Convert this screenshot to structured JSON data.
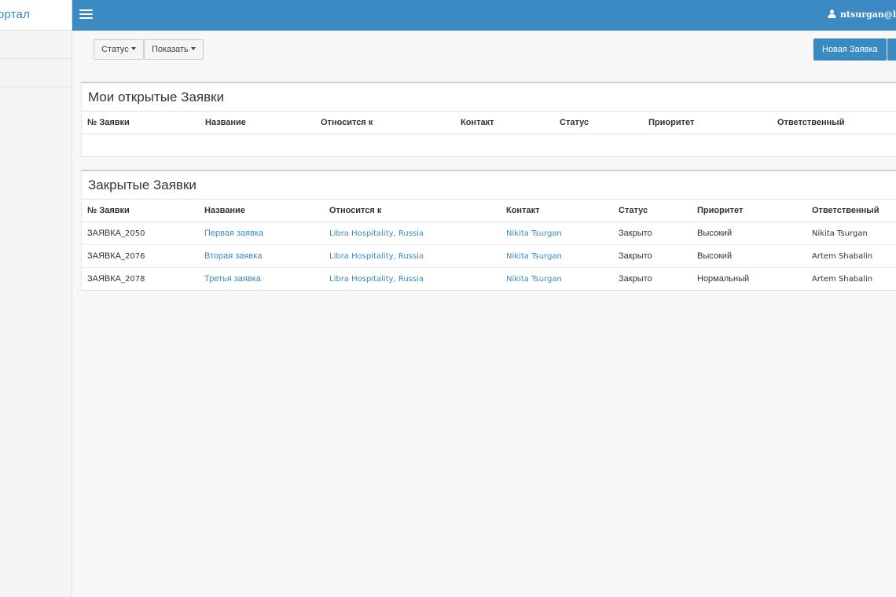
{
  "brand": {
    "title": "ортал"
  },
  "topbar": {
    "user": "ntsurgan@l"
  },
  "toolbar": {
    "status_label": "Статус",
    "show_label": "Показать",
    "new_ticket_label": "Новая Заявка"
  },
  "open_panel": {
    "title": "Мои открытые Заявки",
    "headers": [
      "№ Заявки",
      "Название",
      "Относится к",
      "Контакт",
      "Статус",
      "Приоритет",
      "Ответственный"
    ]
  },
  "closed_panel": {
    "title": "Закрытые Заявки",
    "headers": [
      "№ Заявки",
      "Название",
      "Относится к",
      "Контакт",
      "Статус",
      "Приоритет",
      "Ответственный"
    ],
    "rows": [
      {
        "id_prefix": "ЗАЯВКА",
        "id_num": "_2050",
        "name": "Первая заявка",
        "related": "Libra Hospitality, Russia",
        "contact": "Nikita Tsurgan",
        "status": "Закрыто",
        "priority": "Высокий",
        "owner": "Nikita Tsurgan"
      },
      {
        "id_prefix": "ЗАЯВКА",
        "id_num": "_2076",
        "name": "Вторая заявка",
        "related": "Libra Hospitality, Russia",
        "contact": "Nikita Tsurgan",
        "status": "Закрыто",
        "priority": "Высокий",
        "owner": "Artem Shabalin"
      },
      {
        "id_prefix": "ЗАЯВКА",
        "id_num": "_2078",
        "name": "Третья заявка",
        "related": "Libra Hospitality, Russia",
        "contact": "Nikita Tsurgan",
        "status": "Закрыто",
        "priority": "Нормальный",
        "owner": "Artem Shabalin"
      }
    ]
  },
  "colors": {
    "accent": "#3b8ac4"
  },
  "icons": {
    "menu": "hamburger-icon",
    "user": "user-icon",
    "dropdown": "caret-down-icon"
  }
}
